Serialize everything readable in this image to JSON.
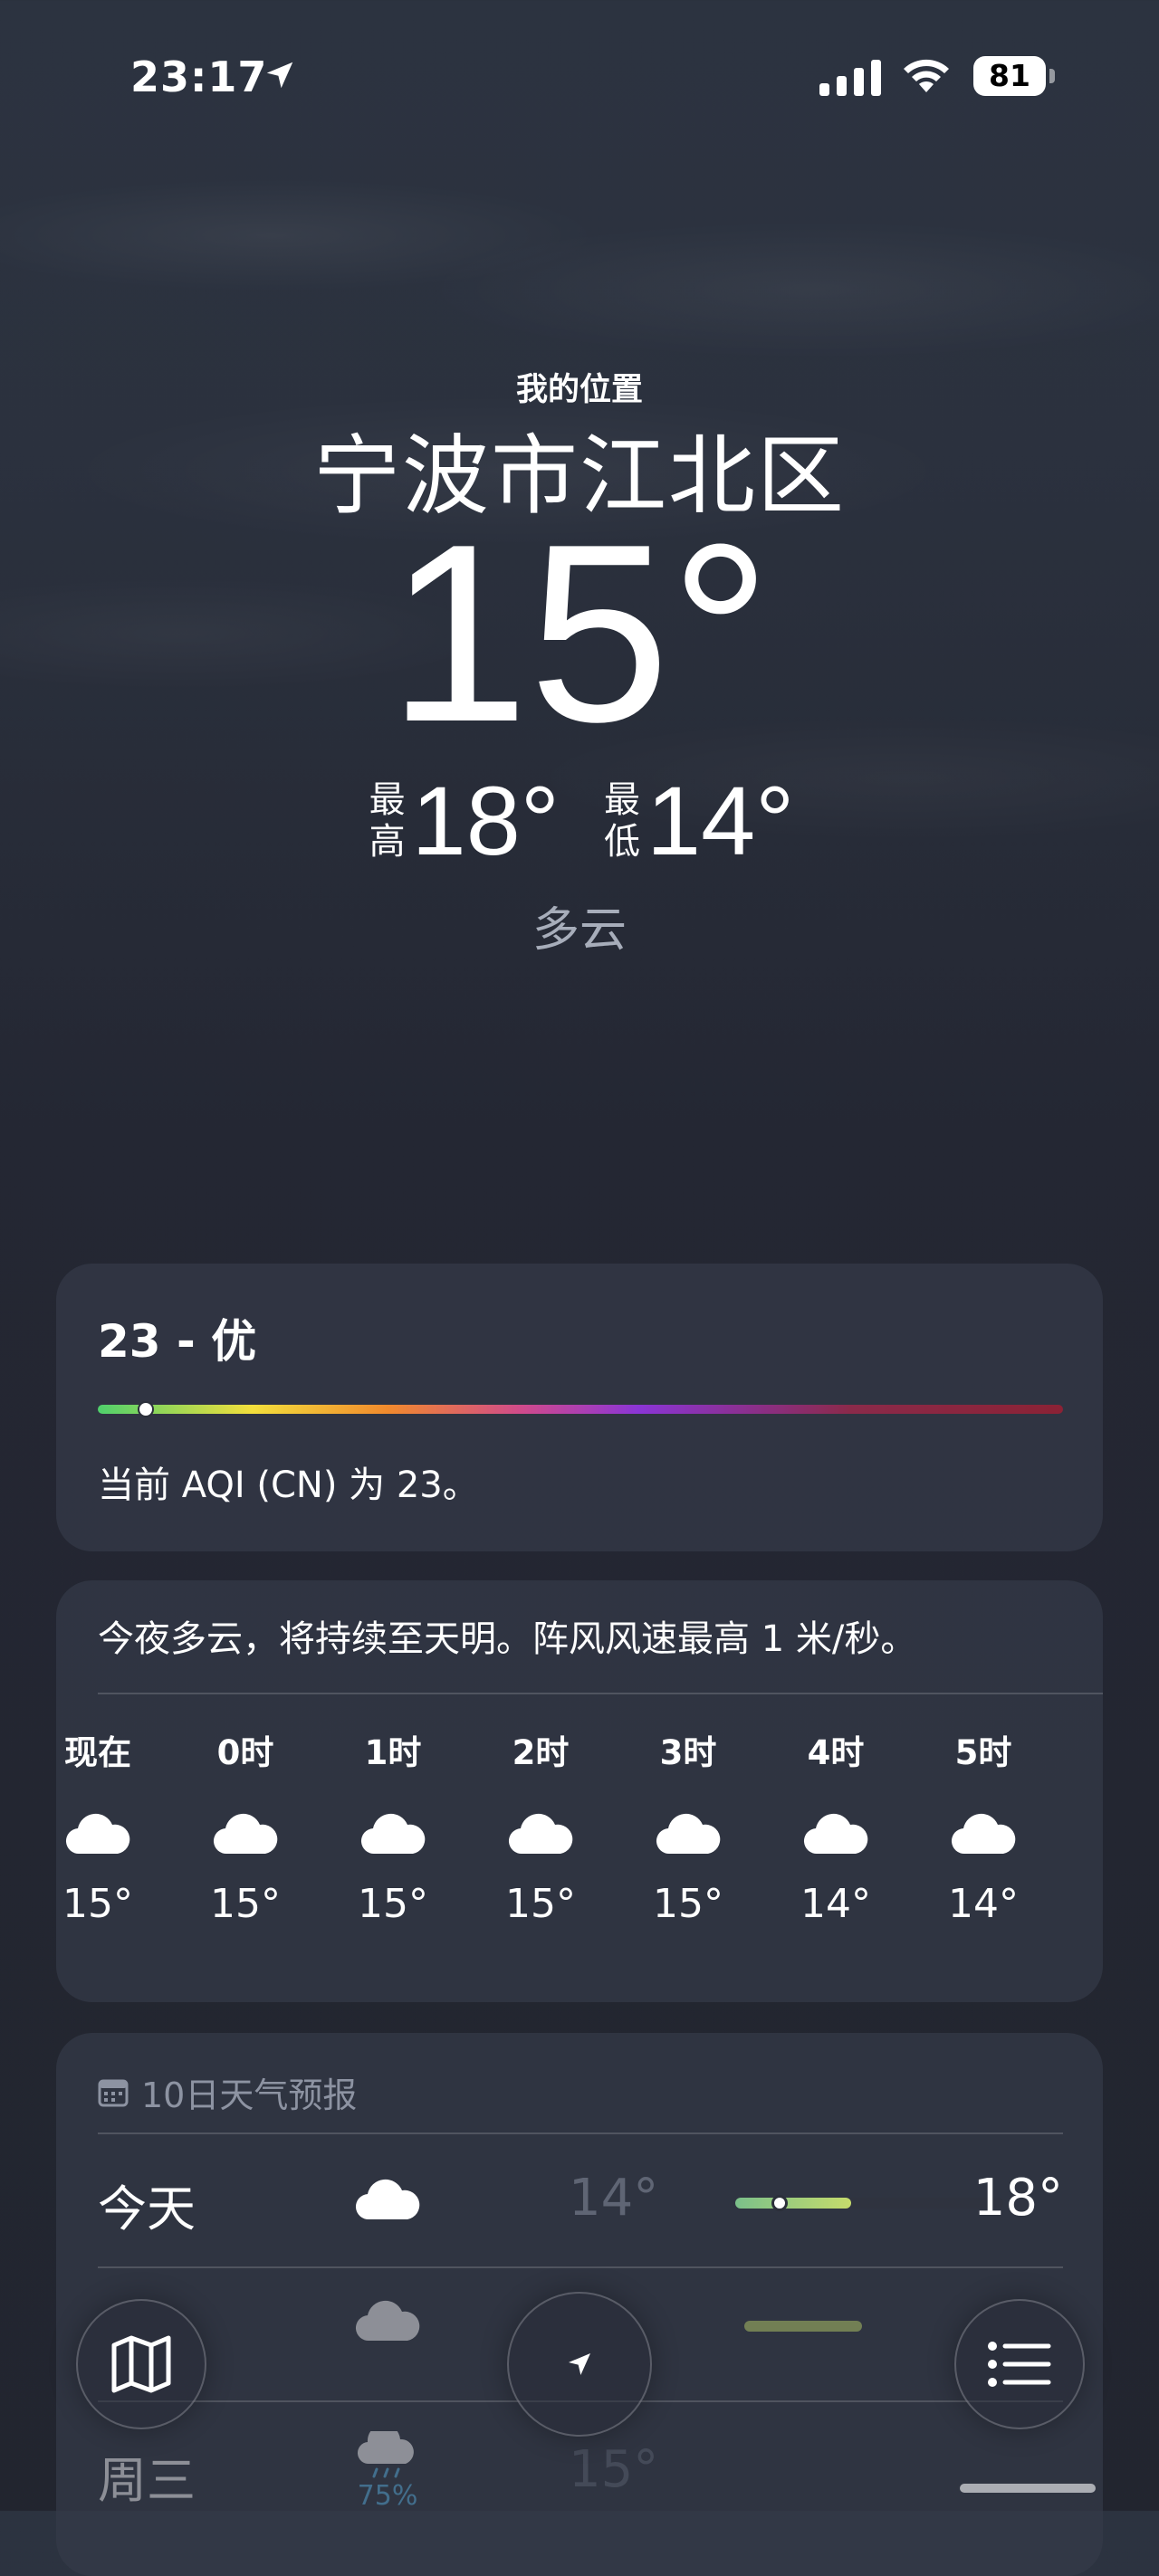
{
  "status_bar": {
    "time": "23:17",
    "battery": "81"
  },
  "header": {
    "subtitle": "我的位置",
    "city": "宁波市江北区",
    "temperature": "15°",
    "high_label": "最高",
    "high_value": "18°",
    "low_label": "最低",
    "low_value": "14°",
    "condition": "多云"
  },
  "aqi": {
    "title": "23 - 优",
    "description": "当前 AQI (CN) 为 23。",
    "level": 0.05
  },
  "hourly": {
    "summary": "今夜多云，将持续至天明。阵风风速最高 1 米/秒。",
    "items": [
      {
        "label": "现在",
        "icon": "cloud-icon",
        "temp": "15°"
      },
      {
        "label": "0时",
        "icon": "cloud-icon",
        "temp": "15°"
      },
      {
        "label": "1时",
        "icon": "cloud-icon",
        "temp": "15°"
      },
      {
        "label": "2时",
        "icon": "cloud-icon",
        "temp": "15°"
      },
      {
        "label": "3时",
        "icon": "cloud-icon",
        "temp": "15°"
      },
      {
        "label": "4时",
        "icon": "cloud-icon",
        "temp": "14°"
      },
      {
        "label": "5时",
        "icon": "cloud-icon",
        "temp": "14°"
      }
    ]
  },
  "ten_day": {
    "title": "10日天气预报",
    "days": [
      {
        "day": "今天",
        "icon": "cloud-icon",
        "low": "14°",
        "high": "18°"
      },
      {
        "day": "",
        "icon": "cloud-icon",
        "low": "",
        "high": ""
      },
      {
        "day": "周三",
        "icon": "cloud-rain-icon",
        "precip": "75%",
        "low": "15°",
        "high": ""
      }
    ]
  },
  "toolbar": {
    "map": "map-icon",
    "location": "location-arrow-icon",
    "list": "list-icon"
  },
  "colors": {
    "aqi_good": "#4fd06c",
    "precip": "#5ab4e8"
  }
}
